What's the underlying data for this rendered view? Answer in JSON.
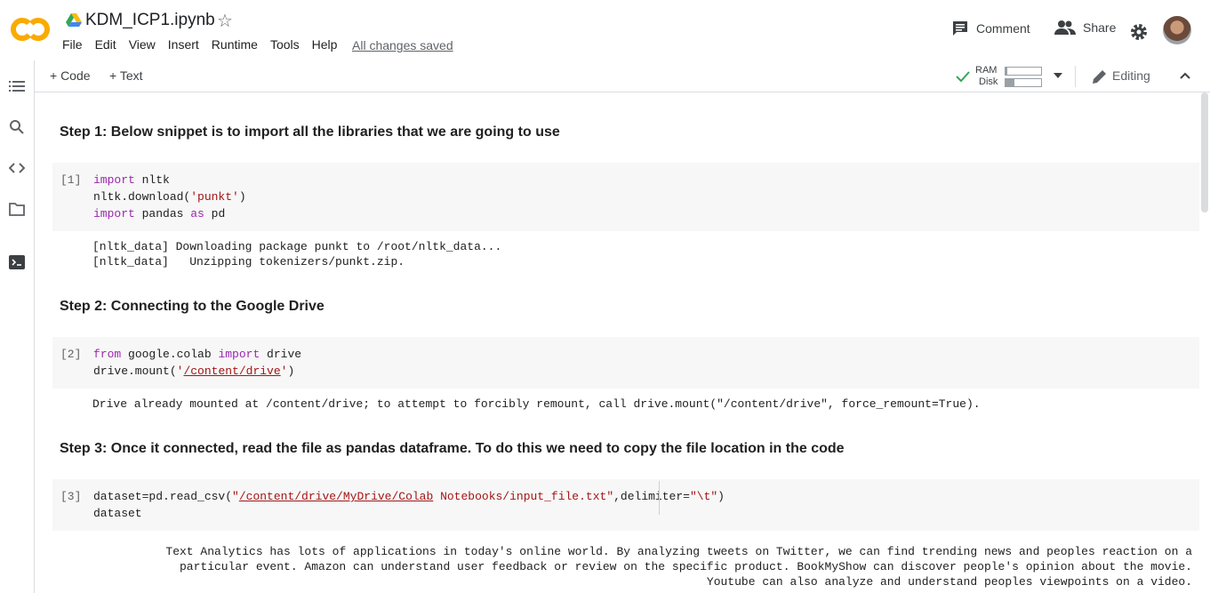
{
  "app": {
    "title": "KDM_ICP1.ipynb",
    "menu": [
      "File",
      "Edit",
      "View",
      "Insert",
      "Runtime",
      "Tools",
      "Help"
    ],
    "saved_status": "All changes saved",
    "comment_label": "Comment",
    "share_label": "Share"
  },
  "toolbar": {
    "code_label": "+ Code",
    "text_label": "+ Text",
    "ram_label": "RAM",
    "disk_label": "Disk",
    "ram_usage": 0.05,
    "disk_usage": 0.25,
    "editing_label": "Editing"
  },
  "cells": {
    "step1": "Step 1: Below snippet is to import all the libraries that we are going to use",
    "cell1_exec": "[1]",
    "cell1_output": "[nltk_data] Downloading package punkt to /root/nltk_data...\n[nltk_data]   Unzipping tokenizers/punkt.zip.",
    "step2": "Step 2: Connecting to the Google Drive",
    "cell2_exec": "[2]",
    "cell2_output": "Drive already mounted at /content/drive; to attempt to forcibly remount, call drive.mount(\"/content/drive\", force_remount=True).",
    "step3": "Step 3: Once it connected, read the file as pandas dataframe. To do this we need to copy the file location in the code",
    "cell3_exec": "[3]",
    "cell3_output": "Text Analytics has lots of applications in today's online world. By analyzing tweets on Twitter, we can find trending news and peoples reaction on a particular event. Amazon can understand user feedback or review on the specific product. BookMyShow can discover people's opinion about the movie. Youtube can also analyze and understand peoples viewpoints on a video."
  },
  "code": {
    "import": "import",
    "as": "as",
    "from": "from",
    "c1_l1": " nltk",
    "c1_l2a": "nltk.download(",
    "c1_l2s": "'punkt'",
    "c1_l2b": ")",
    "c1_l3a": " pandas ",
    "c1_l3b": " pd",
    "c2_l1a": " google.colab ",
    "c2_l1b": " drive",
    "c2_l2a": "drive.mount(",
    "c2_l2q1": "'",
    "c2_l2link": "/content/drive",
    "c2_l2q2": "'",
    "c2_l2b": ")",
    "c3_l1a": "dataset=pd.read_csv(",
    "c3_l1q1": "\"",
    "c3_l1link": "/content/drive/MyDrive/Colab",
    "c3_l1rest": " Notebooks/input_file.txt\"",
    "c3_l1b": ",delimiter=",
    "c3_l1s": "\"\\t\"",
    "c3_l1c": ")",
    "c3_l2": "dataset"
  },
  "colors": {
    "logo_orange": "#f9ab00",
    "keyword": "#9c27b0",
    "string": "#a31515",
    "check": "#34a853"
  }
}
